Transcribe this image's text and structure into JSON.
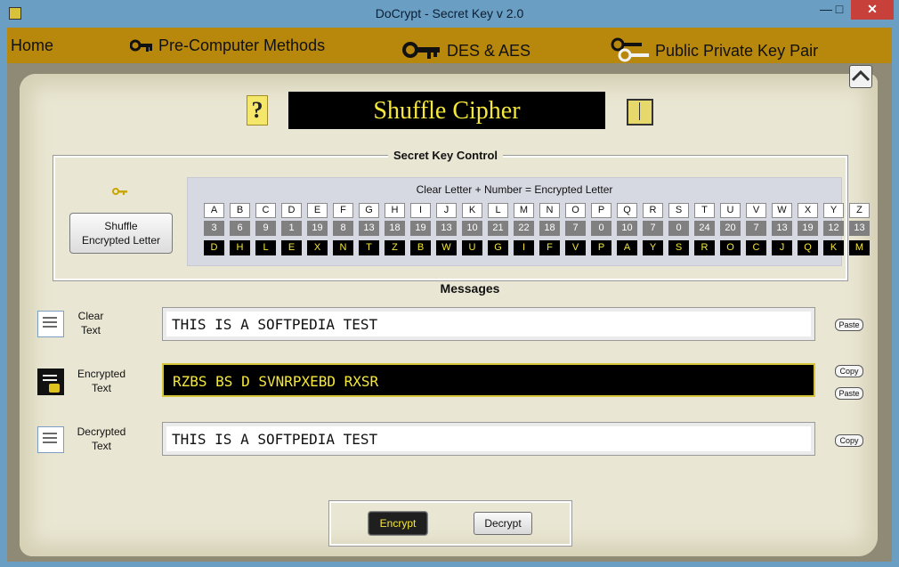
{
  "window": {
    "title": "DoCrypt - Secret Key v 2.0",
    "controls": {
      "minimize": "—",
      "maximize": "□",
      "close": "✕"
    }
  },
  "menu": {
    "home": "Home",
    "pre_computer": "Pre-Computer Methods",
    "des_aes": "DES & AES",
    "public_private": "Public Private Key Pair"
  },
  "header": {
    "title": "Shuffle Cipher",
    "help": "?"
  },
  "secret_key_control": {
    "legend": "Secret Key Control",
    "shuffle_button": "Shuffle\nEncrypted Letter",
    "caption": "Clear Letter + Number = Encrypted Letter",
    "letters": [
      "A",
      "B",
      "C",
      "D",
      "E",
      "F",
      "G",
      "H",
      "I",
      "J",
      "K",
      "L",
      "M",
      "N",
      "O",
      "P",
      "Q",
      "R",
      "S",
      "T",
      "U",
      "V",
      "W",
      "X",
      "Y",
      "Z"
    ],
    "numbers": [
      "3",
      "6",
      "9",
      "1",
      "19",
      "8",
      "13",
      "18",
      "19",
      "13",
      "10",
      "21",
      "22",
      "18",
      "7",
      "0",
      "10",
      "7",
      "0",
      "24",
      "20",
      "7",
      "13",
      "19",
      "12",
      "13"
    ],
    "encrypted": [
      "D",
      "H",
      "L",
      "E",
      "X",
      "N",
      "T",
      "Z",
      "B",
      "W",
      "U",
      "G",
      "I",
      "F",
      "V",
      "P",
      "A",
      "Y",
      "S",
      "R",
      "O",
      "C",
      "J",
      "Q",
      "K",
      "M"
    ]
  },
  "messages": {
    "title": "Messages",
    "clear": {
      "label": "Clear\nText",
      "value": "THIS IS A SOFTPEDIA TEST",
      "paste": "Paste"
    },
    "encrypted": {
      "label": "Encrypted\nText",
      "value": "RZBS BS D SVNRPXEBD RXSR",
      "copy": "Copy",
      "paste": "Paste"
    },
    "decrypted": {
      "label": "Decrypted\nText",
      "value": "THIS IS A SOFTPEDIA TEST",
      "copy": "Copy"
    }
  },
  "actions": {
    "encrypt": "Encrypt",
    "decrypt": "Decrypt"
  }
}
